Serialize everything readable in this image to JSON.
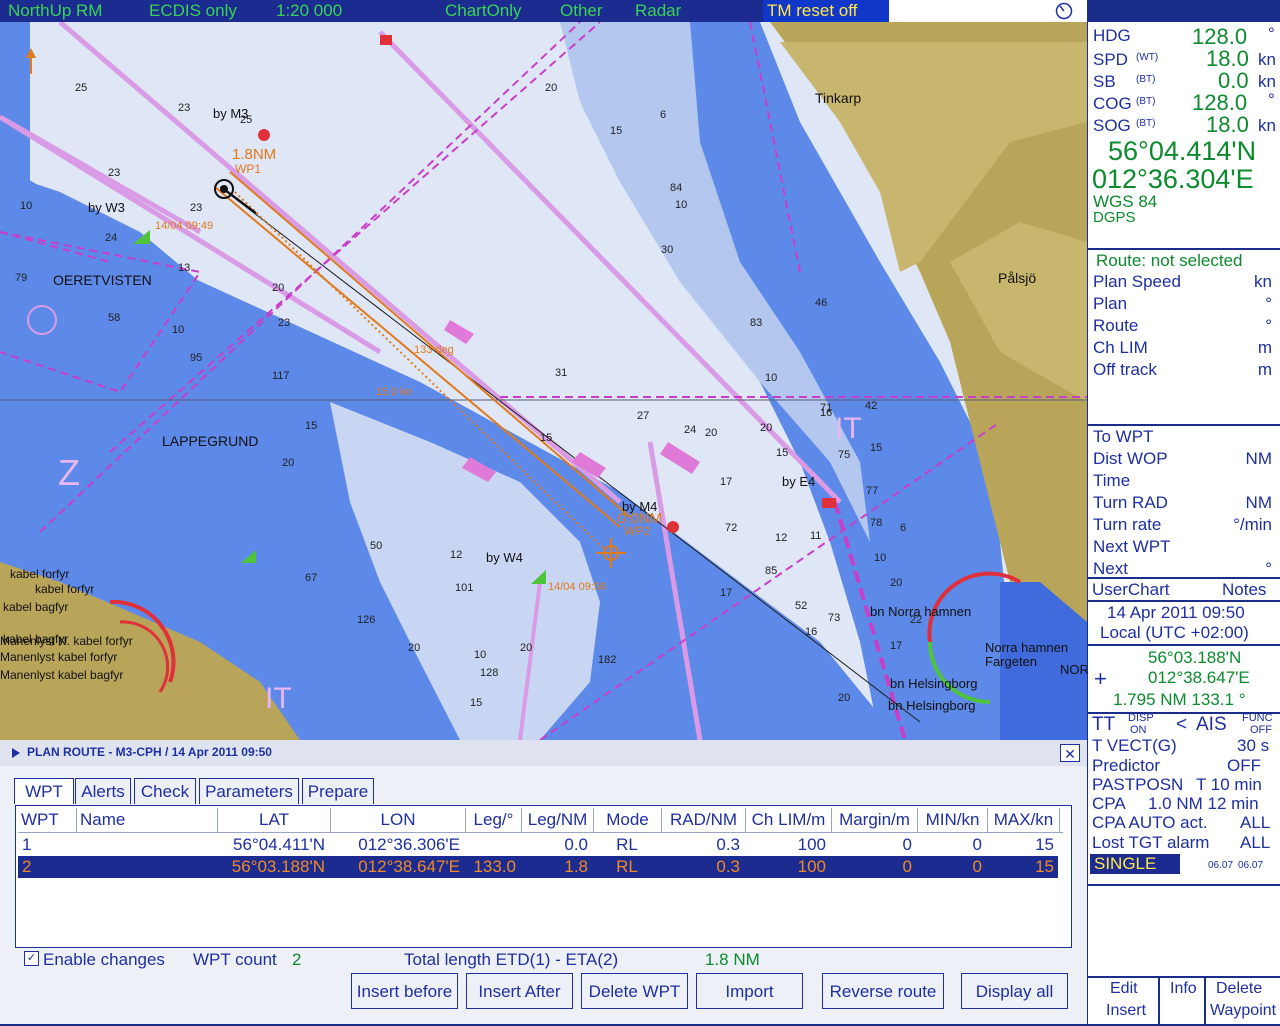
{
  "topbar": {
    "orientation": "NorthUp RM",
    "mode": "ECDIS only",
    "scale": "1:20 000",
    "chart_only": "ChartOnly",
    "other": "Other",
    "radar": "Radar",
    "tm_reset": "TM reset off"
  },
  "chart": {
    "labels": [
      "by M3",
      "1.8NM",
      "WP1",
      "by W3",
      "14/04 09:49",
      "OERETVISTEN",
      "LAPPEGRUND",
      "Tinkarp",
      "Pålsjö",
      "by M4",
      "0.0NM",
      "WP2",
      "by E4",
      "by W4",
      "14/04 09:56",
      "15.0 kn",
      "133 deg",
      "bn Norra hamnen",
      "Norra hamnen",
      "Fargeten",
      "bn Helsingborg",
      "bn Helsingborg",
      "kabel forfyr",
      "kabel bagfyr",
      "kabel forfyr",
      "kabel bagfyr",
      "Manenlyst N. kabel forfyr",
      "Manenlyst kabel forfyr",
      "Manenlyst kabel bagfyr",
      "NOR",
      "IT",
      "IT",
      "Z"
    ],
    "depths": [
      "25",
      "23",
      "25",
      "10",
      "23",
      "23",
      "24",
      "13",
      "79",
      "58",
      "10",
      "95",
      "117",
      "20",
      "23",
      "20",
      "31",
      "27",
      "24",
      "20",
      "20",
      "15",
      "6",
      "84",
      "10",
      "30",
      "46",
      "83",
      "10",
      "16",
      "71",
      "42",
      "17",
      "15",
      "75",
      "15",
      "77",
      "11",
      "85",
      "73",
      "12",
      "50",
      "126",
      "101",
      "10",
      "128",
      "182",
      "20",
      "15",
      "20",
      "20",
      "15",
      "67",
      "72",
      "52",
      "17",
      "16",
      "20",
      "22",
      "20",
      "17",
      "78",
      "10",
      "6",
      "15",
      "12"
    ]
  },
  "status_panel": {
    "hdg_label": "HDG",
    "hdg_value": "128.0",
    "hdg_unit": "°",
    "spd_label": "SPD",
    "spd_sub": "(WT)",
    "spd_value": "18.0",
    "spd_unit": "kn",
    "sb_label": "SB",
    "sb_sub": "(BT)",
    "sb_value": "0.0",
    "sb_unit": "kn",
    "cog_label": "COG",
    "cog_sub": "(BT)",
    "cog_value": "128.0",
    "cog_unit": "°",
    "sog_label": "SOG",
    "sog_sub": "(BT)",
    "sog_value": "18.0",
    "sog_unit": "kn",
    "lat": "56°04.414'N",
    "lon": "012°36.304'E",
    "datum": "WGS 84",
    "fix": "DGPS"
  },
  "route_panel": {
    "route_status": "Route: not selected",
    "rows": [
      {
        "label": "Plan Speed",
        "unit": "kn"
      },
      {
        "label": "Plan",
        "unit": "°"
      },
      {
        "label": "Route",
        "unit": "°"
      },
      {
        "label": "Ch LIM",
        "unit": "m"
      },
      {
        "label": "Off track",
        "unit": "m"
      }
    ]
  },
  "wpt_panel": {
    "rows": [
      {
        "label": "To WPT",
        "unit": ""
      },
      {
        "label": "Dist WOP",
        "unit": "NM"
      },
      {
        "label": "Time",
        "unit": ""
      },
      {
        "label": "Turn RAD",
        "unit": "NM"
      },
      {
        "label": "Turn rate",
        "unit": "°/min"
      },
      {
        "label": "Next WPT",
        "unit": ""
      },
      {
        "label": "Next",
        "unit": "°"
      }
    ]
  },
  "userchart": {
    "label": "UserChart",
    "notes": "Notes"
  },
  "time_panel": {
    "date": "14 Apr 2011 09:50",
    "zone": "Local (UTC +02:00)"
  },
  "cursor_panel": {
    "lat": "56°03.188'N",
    "lon": "012°38.647'E",
    "range_bearing": "1.795 NM  133.1 °"
  },
  "target_panel": {
    "tt": "TT",
    "disp": "DISP",
    "disp_state": "ON",
    "ais_arrow": "<",
    "ais": "AIS",
    "func": "FUNC",
    "func_state": "OFF",
    "tvect_label": "T VECT(G)",
    "tvect_value": "30 s",
    "predictor_label": "Predictor",
    "predictor_value": "OFF",
    "pastposn_label": "PASTPOSN",
    "pastposn_value": "T 10 min",
    "cpa_label": "CPA",
    "cpa_value": "1.0 NM 12 min",
    "cpa_auto_label": "CPA AUTO act.",
    "cpa_auto_value": "ALL",
    "lost_label": "Lost TGT alarm",
    "lost_value": "ALL",
    "single": "SINGLE",
    "ver1": "06.07",
    "ver2": "06.07"
  },
  "bottom_actions": {
    "edit": "Edit",
    "insert": "Insert",
    "info": "Info",
    "delete": "Delete",
    "waypoint": "Waypoint"
  },
  "dialog": {
    "title": "PLAN ROUTE - M3-CPH / 14 Apr 2011 09:50",
    "tabs": [
      "WPT",
      "Alerts",
      "Check",
      "Parameters",
      "Prepare"
    ],
    "columns": [
      "WPT",
      "Name",
      "LAT",
      "LON",
      "Leg/°",
      "Leg/NM",
      "Mode",
      "RAD/NM",
      "Ch LIM/m",
      "Margin/m",
      "MIN/kn",
      "MAX/kn"
    ],
    "rows": [
      [
        "1",
        "",
        "56°04.411'N",
        "012°36.306'E",
        "",
        "0.0",
        "RL",
        "0.3",
        "100",
        "0",
        "0",
        "15"
      ],
      [
        "2",
        "",
        "56°03.188'N",
        "012°38.647'E",
        "133.0",
        "1.8",
        "RL",
        "0.3",
        "100",
        "0",
        "0",
        "15"
      ]
    ],
    "enable_changes": "Enable changes",
    "wpt_count_label": "WPT count",
    "wpt_count": "2",
    "total_length_label": "Total length ETD(1) - ETA(2)",
    "total_length": "1.8 NM",
    "buttons": [
      "Insert before",
      "Insert After",
      "Delete WPT",
      "Import",
      "Reverse route",
      "Display all"
    ],
    "close": "✕"
  }
}
